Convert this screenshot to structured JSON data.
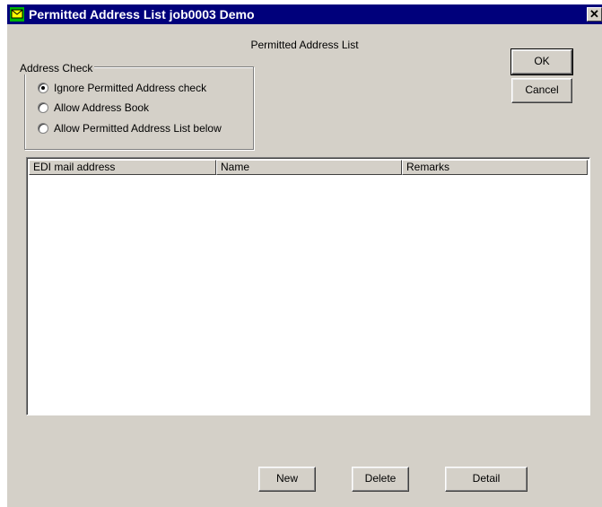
{
  "window": {
    "title": "Permitted Address List job0003 Demo",
    "close_glyph": "✕"
  },
  "caption": "Permitted Address List",
  "buttons": {
    "ok": "OK",
    "cancel": "Cancel",
    "new": "New",
    "delete": "Delete",
    "detail": "Detail"
  },
  "address_check": {
    "legend": "Address Check",
    "options": [
      {
        "label": "Ignore Permitted Address check",
        "selected": true
      },
      {
        "label": "Allow Address Book",
        "selected": false
      },
      {
        "label": "Allow Permitted Address List below",
        "selected": false
      }
    ]
  },
  "list": {
    "columns": [
      "EDI mail address",
      "Name",
      "Remarks"
    ],
    "rows": []
  },
  "colors": {
    "titlebar": "#00007b",
    "face": "#d4d0c8"
  }
}
